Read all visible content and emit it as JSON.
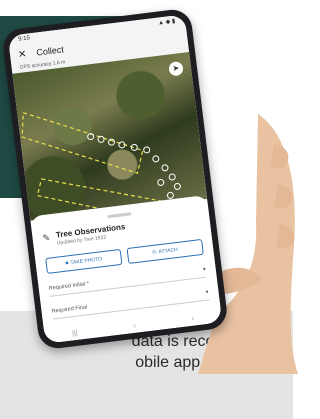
{
  "caption": {
    "line1": "data is recorded on a",
    "line2": "obile app in the field."
  },
  "phone": {
    "status": {
      "time": "9:15",
      "icons": "▲ ◆ ▮"
    },
    "appbar": {
      "close_icon": "close-icon",
      "title": "Collect"
    },
    "gps_text": "GPS accuracy 1.6 m",
    "sheet": {
      "title": "Tree Observations",
      "subtitle": "Updated by Tree 1922",
      "take_photo": "TAKE PHOTO",
      "attach": "ATTACH",
      "field1": "Required Initial *",
      "field2": "Required Final"
    },
    "nav": {
      "back": "‹",
      "home": "○",
      "recent": "|||"
    }
  },
  "colors": {
    "teal": "#1f4a44",
    "caption_bg": "#e4e4e4",
    "accent": "#2a6fb5"
  }
}
